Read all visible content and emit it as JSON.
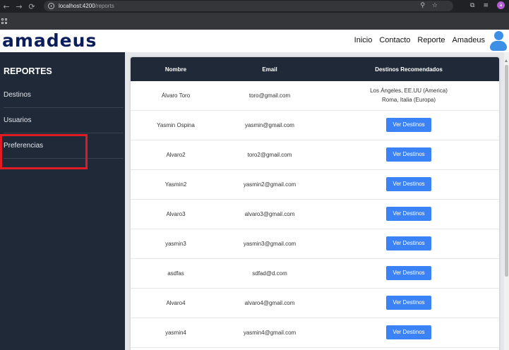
{
  "browser": {
    "url_host": "localhost:4200",
    "url_path": "/reports",
    "profile_initial": "a"
  },
  "header": {
    "logo": "amadeus",
    "nav": [
      "Inicio",
      "Contacto",
      "Reporte",
      "Amadeus"
    ]
  },
  "sidebar": {
    "title": "REPORTES",
    "items": [
      "Destinos",
      "Usuarios",
      "Preferencias"
    ]
  },
  "table": {
    "headers": [
      "Nombre",
      "Email",
      "Destinos Recomendados"
    ],
    "button_label": "Ver Destinos",
    "rows": [
      {
        "name": "Álvaro Toro",
        "email": "toro@gmail.com",
        "dest_line1": "Los Ángeles, EE.UU (America)",
        "dest_line2": "Roma, Italia (Europa)"
      },
      {
        "name": "Yasmin Ospina",
        "email": "yasmin@gmail.com"
      },
      {
        "name": "Alvaro2",
        "email": "toro2@gmail.com"
      },
      {
        "name": "Yasmin2",
        "email": "yasmin2@gmail.com"
      },
      {
        "name": "Alvaro3",
        "email": "alvaro3@gmail.com"
      },
      {
        "name": "yasmin3",
        "email": "yasmin3@gmail.com"
      },
      {
        "name": "asdfas",
        "email": "sdfad@d.com"
      },
      {
        "name": "Alvaro4",
        "email": "alvaro4@gmail.com"
      },
      {
        "name": "yasmin4",
        "email": "yasmin4@gmail.com"
      }
    ]
  },
  "colors": {
    "sidebar_bg": "#1f2937",
    "button_bg": "#3b82f6",
    "highlight": "#e01b24",
    "logo": "#0b1e5b"
  }
}
